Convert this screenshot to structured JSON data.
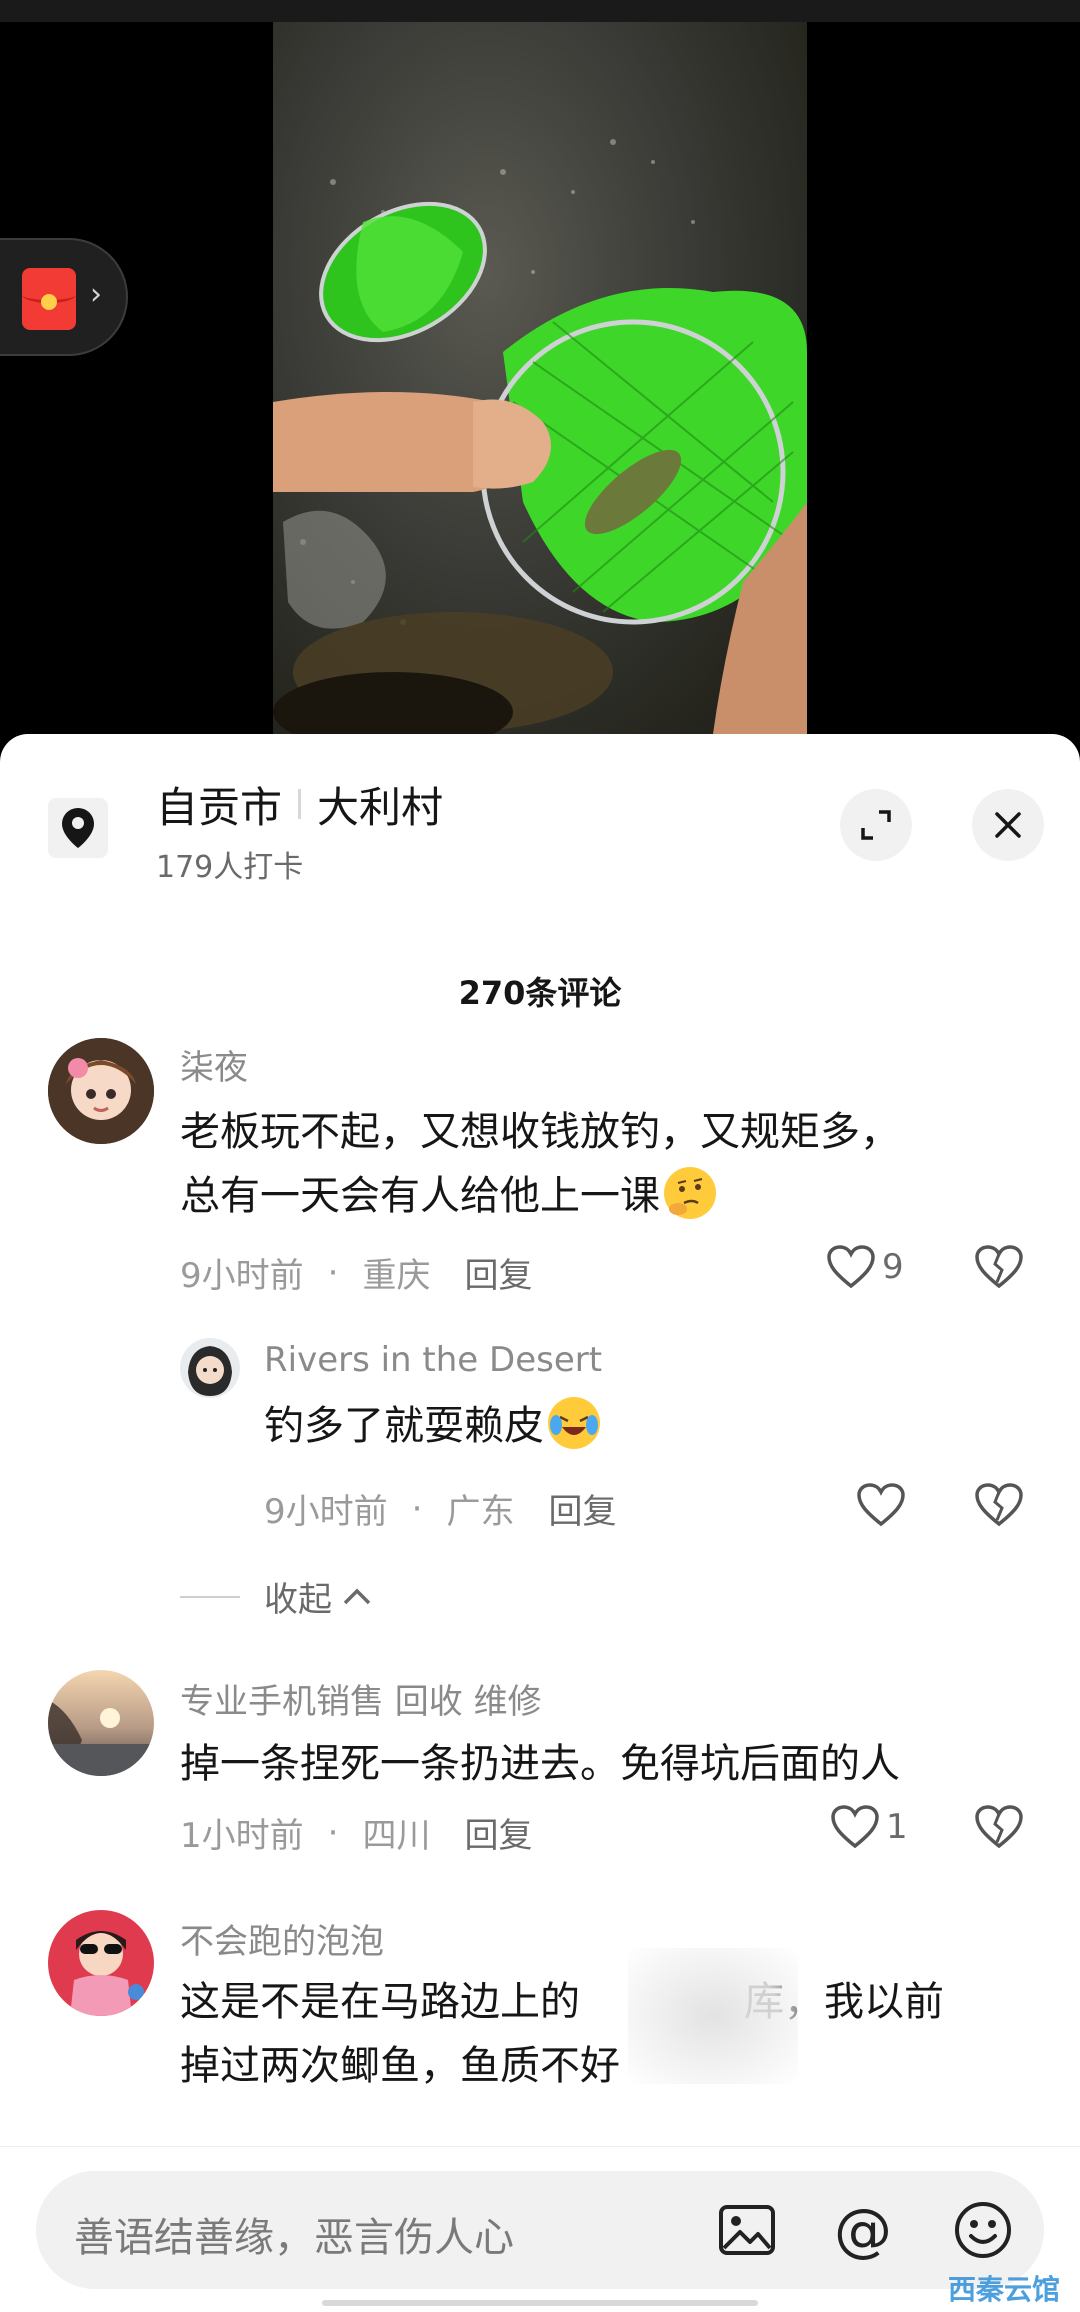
{
  "location": {
    "city": "自贡市",
    "place": "大利村",
    "checkins": "179人打卡"
  },
  "comments_count": "270条评论",
  "comments": [
    {
      "name": "柒夜",
      "text_line1": "老板玩不起，又想收钱放钓，又规矩多，",
      "text_line2": "总有一天会有人给他上一课",
      "time": "9小时前",
      "region": "重庆",
      "reply_label": "回复",
      "likes": "9"
    },
    {
      "name": "专业手机销售 回收 维修",
      "text_line1": "掉一条捏死一条扔进去。免得坑后面的人",
      "time": "1小时前",
      "region": "四川",
      "reply_label": "回复",
      "likes": "1"
    },
    {
      "name": "不会跑的泡泡",
      "text_line1": "这是不是在马路边上的",
      "text_line1_tail": "库，我以前",
      "text_line2": "掉过两次鲫鱼，鱼质不好"
    }
  ],
  "reply": {
    "name": "Rivers in the Desert",
    "text": "钓多了就耍赖皮",
    "time": "9小时前",
    "region": "广东",
    "reply_label": "回复"
  },
  "meta_separator": "·",
  "collapse_label": "收起",
  "input": {
    "placeholder": "善语结善缘，恶言伤人心",
    "at_symbol": "@"
  },
  "watermark": "西秦云馆",
  "icons": {
    "location": "location-pin-icon",
    "expand": "expand-icon",
    "close": "close-icon",
    "like": "heart-icon",
    "dislike": "broken-heart-icon",
    "image": "image-icon",
    "emoji": "emoji-icon",
    "red_packet": "red-packet-icon"
  },
  "colors": {
    "net_green": "#3fd62a",
    "red_packet": "#f23b35",
    "text_primary": "#161616",
    "text_secondary": "#8a8a8a"
  }
}
